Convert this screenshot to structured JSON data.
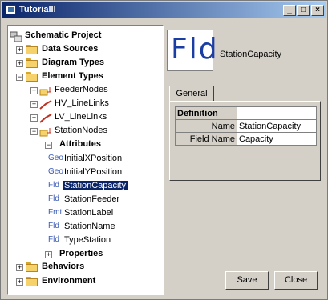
{
  "window": {
    "title": "TutorialII"
  },
  "tree": {
    "root": "Schematic Project",
    "data_sources": "Data Sources",
    "diagram_types": "Diagram Types",
    "element_types": "Element Types",
    "feeder_nodes": "FeederNodes",
    "hv_linelinks": "HV_LineLinks",
    "lv_linelinks": "LV_LineLinks",
    "station_nodes": "StationNodes",
    "attributes": "Attributes",
    "attr_items": [
      {
        "tag": "Geo",
        "name": "InitialXPosition"
      },
      {
        "tag": "Geo",
        "name": "InitialYPosition"
      },
      {
        "tag": "Fld",
        "name": "StationCapacity"
      },
      {
        "tag": "Fld",
        "name": "StationFeeder"
      },
      {
        "tag": "Fmt",
        "name": "StationLabel"
      },
      {
        "tag": "Fld",
        "name": "StationName"
      },
      {
        "tag": "Fld",
        "name": "TypeStation"
      }
    ],
    "properties": "Properties",
    "behaviors": "Behaviors",
    "environment": "Environment"
  },
  "detail": {
    "icon_text": "Fld",
    "name": "StationCapacity",
    "tab": "General",
    "definition_label": "Definition",
    "rows": [
      {
        "key": "Name",
        "value": "StationCapacity"
      },
      {
        "key": "Field Name",
        "value": "Capacity"
      }
    ]
  },
  "buttons": {
    "save": "Save",
    "close": "Close"
  },
  "colors": {
    "selection": "#0a246a",
    "folder": "#f5d26b",
    "tag_text": "#3b5bb5",
    "line_link": "#c03020"
  }
}
